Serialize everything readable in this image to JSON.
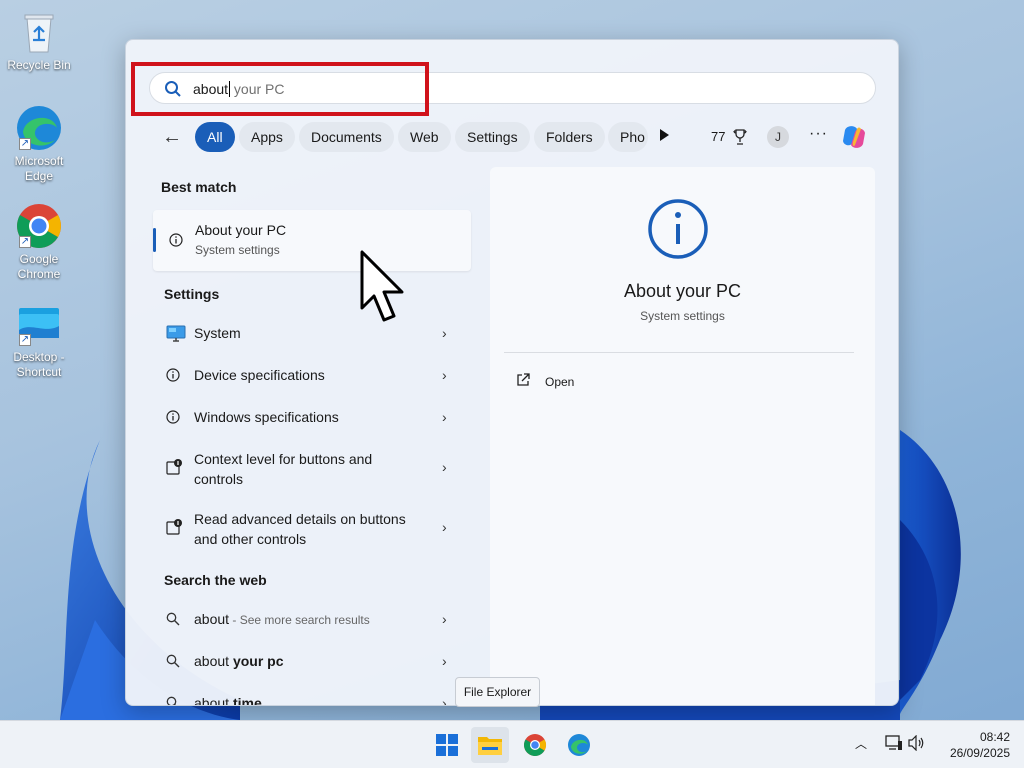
{
  "desktop": {
    "icons": [
      {
        "label": "Recycle Bin",
        "icon": "recycle-bin-icon"
      },
      {
        "label": "Microsoft Edge",
        "icon": "edge-icon"
      },
      {
        "label": "Google Chrome",
        "icon": "chrome-icon"
      },
      {
        "label": "Desktop - Shortcut",
        "icon": "folder-shortcut-icon"
      }
    ]
  },
  "search": {
    "typed": "about",
    "suggestion": " your PC"
  },
  "filters": {
    "tabs": [
      "All",
      "Apps",
      "Documents",
      "Web",
      "Settings",
      "Folders",
      "Pho"
    ],
    "active": "All",
    "points": "77",
    "avatar_initial": "J",
    "more": "···"
  },
  "results": {
    "best_match_title": "Best match",
    "best_match": {
      "title": "About your PC",
      "subtitle": "System settings"
    },
    "settings_title": "Settings",
    "settings": [
      {
        "label": "System",
        "icon": "monitor-icon"
      },
      {
        "label": "Device specifications",
        "icon": "info-icon"
      },
      {
        "label": "Windows specifications",
        "icon": "info-icon"
      },
      {
        "label": "Context level for buttons and controls",
        "icon": "accessibility-icon"
      },
      {
        "label": "Read advanced details on buttons and other controls",
        "icon": "accessibility-icon"
      }
    ],
    "web_title": "Search the web",
    "web": [
      {
        "bold": "about",
        "rest": " - See more search results"
      },
      {
        "bold": "",
        "pre": "about ",
        "strong": "your pc"
      },
      {
        "bold": "",
        "pre": "about ",
        "strong": "time"
      }
    ]
  },
  "preview": {
    "title": "About your PC",
    "subtitle": "System settings",
    "action": "Open"
  },
  "tooltip": "File Explorer",
  "taskbar": {
    "time": "08:42",
    "date": "26/09/2025"
  },
  "colors": {
    "accent": "#1a5eb8",
    "highlight": "#d0121b"
  }
}
